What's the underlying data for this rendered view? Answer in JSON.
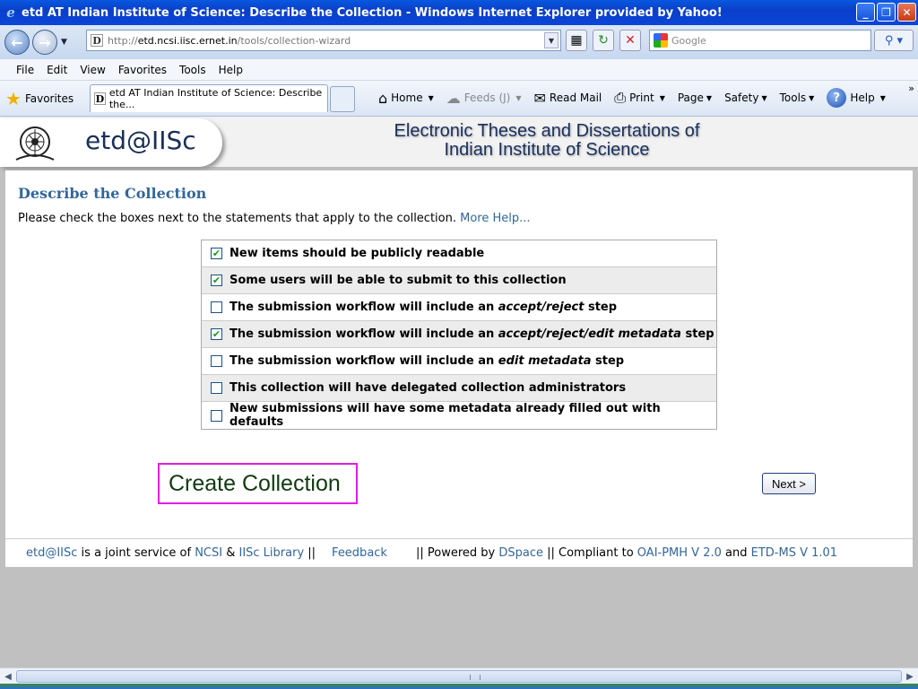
{
  "window": {
    "title": "etd AT Indian Institute of Science: Describe the Collection - Windows Internet Explorer provided by Yahoo!",
    "minimize": "_",
    "restore": "❐",
    "close": "✕"
  },
  "address": {
    "url_prefix": "http://",
    "url_host": "etd.ncsi.iisc.ernet.in",
    "url_path": "/tools/collection-wizard",
    "search_placeholder": "Google"
  },
  "menu": [
    "File",
    "Edit",
    "View",
    "Favorites",
    "Tools",
    "Help"
  ],
  "favorites_bar": {
    "favorites_label": "Favorites",
    "tab_title": "etd AT Indian Institute of Science: Describe the...",
    "commands": {
      "home": "Home",
      "feeds": "Feeds (J)",
      "read_mail": "Read Mail",
      "print": "Print",
      "page": "Page",
      "safety": "Safety",
      "tools": "Tools",
      "help": "Help"
    }
  },
  "banner": {
    "logo_text": "etd@IISc",
    "title_line1": "Electronic Theses and Dissertations of",
    "title_line2": "Indian Institute of Science"
  },
  "content": {
    "heading": "Describe the Collection",
    "intro": "Please check the boxes next to the statements that apply to the collection.",
    "more_help": "More Help...",
    "options": [
      {
        "pre": "New items should be publicly readable",
        "em": "",
        "post": "",
        "checked": true
      },
      {
        "pre": "Some users will be able to submit to this collection",
        "em": "",
        "post": "",
        "checked": true
      },
      {
        "pre": "The submission workflow will include an ",
        "em": "accept/reject",
        "post": " step",
        "checked": false
      },
      {
        "pre": "The submission workflow will include an ",
        "em": "accept/reject/edit metadata",
        "post": " step",
        "checked": true
      },
      {
        "pre": "The submission workflow will include an ",
        "em": "edit metadata",
        "post": " step",
        "checked": false
      },
      {
        "pre": "This collection will have delegated collection administrators",
        "em": "",
        "post": "",
        "checked": false
      },
      {
        "pre": "New submissions will have some metadata already filled out with defaults",
        "em": "",
        "post": "",
        "checked": false
      }
    ],
    "create_label": "Create Collection",
    "next_label": "Next >"
  },
  "footer": {
    "site": "etd@IISc",
    "t1": " is a joint service of ",
    "ncsi": "NCSI",
    "amp": " & ",
    "library": "IISc Library",
    "sep1": " ||",
    "feedback": "Feedback",
    "t2": "|| Powered by ",
    "dspace": "DSpace",
    "t3": " || Compliant to ",
    "oai": "OAI-PMH V 2.0",
    "and": " and ",
    "etdms": "ETD-MS V 1.01"
  }
}
